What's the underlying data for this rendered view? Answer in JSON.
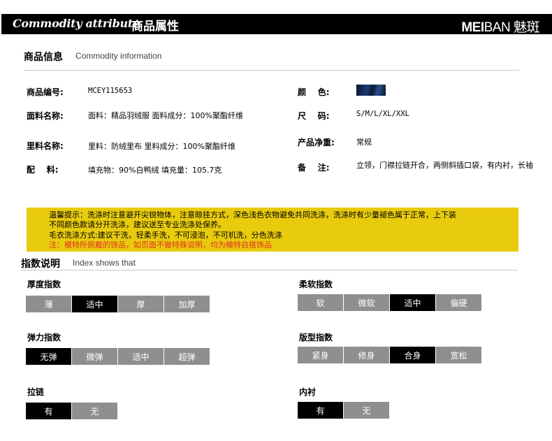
{
  "header": {
    "title_en": "Commodity attribute",
    "title_cn": "商品属性",
    "logo_latin_bold": "MEI",
    "logo_latin_light": "BAN",
    "logo_cn": "魅斑"
  },
  "commodity_info": {
    "heading_cn": "商品信息",
    "heading_en": "Commodity information",
    "left": [
      {
        "label": "商品编号:",
        "value": "MCEY115653"
      },
      {
        "label": "面料名称:",
        "value": "面料：精品羽绒服 面料成分：100%聚酯纤维"
      },
      {
        "label": "里料名称:",
        "value": "里料：防绒里布 里料成分：100%聚酯纤维"
      },
      {
        "label": "配    料:",
        "value": "填充物：90%白鸭绒 填充量：105.7克"
      }
    ],
    "right": [
      {
        "label": "颜    色:",
        "value": ""
      },
      {
        "label": "尺    码:",
        "value": "S/M/L/XL/XXL"
      },
      {
        "label": "产品净重:",
        "value": "常规"
      },
      {
        "label": "备    注:",
        "value": "立领，门襟拉链开合，两侧斜插口袋，有内衬，长袖"
      }
    ],
    "color_swatch": "#1c3a72"
  },
  "notice": {
    "line1": "温馨提示：洗涤时注意避开尖锐物体，注意晾挂方式，深色浅色衣物避免共同洗涤，洗涤时有少量褪色属于正常，上下装",
    "line2": "不同颜色款请分开洗涤，建议送至专业洗涤处保养。",
    "line3": "毛衣洗涤方式:建议干洗，轻柔手洗，不可浸泡，不可机洗，分色洗涤",
    "line4": "注：模特所佩戴的饰品，如页面不做特殊说明，均为模特自搭饰品",
    "background": "#e9cb0e",
    "warning_color": "#e03020"
  },
  "index": {
    "heading_cn": "指数说明",
    "heading_en": "Index shows that",
    "groups": {
      "thickness": {
        "title": "厚度指数",
        "options": [
          "薄",
          "适中",
          "厚",
          "加厚"
        ],
        "selected": "适中"
      },
      "softness": {
        "title": "柔软指数",
        "options": [
          "软",
          "微软",
          "适中",
          "偏硬"
        ],
        "selected": "适中"
      },
      "elasticity": {
        "title": "弹力指数",
        "options": [
          "无弹",
          "微弹",
          "适中",
          "超弹"
        ],
        "selected": "无弹"
      },
      "fit": {
        "title": "版型指数",
        "options": [
          "紧身",
          "修身",
          "合身",
          "宽松"
        ],
        "selected": "合身"
      },
      "zipper": {
        "title": "拉链",
        "options": [
          "有",
          "无"
        ],
        "selected": "有"
      },
      "lining": {
        "title": "内衬",
        "options": [
          "有",
          "无"
        ],
        "selected": "有"
      }
    },
    "selected_color": "#000000",
    "unselected_color": "#8f8f8f"
  }
}
